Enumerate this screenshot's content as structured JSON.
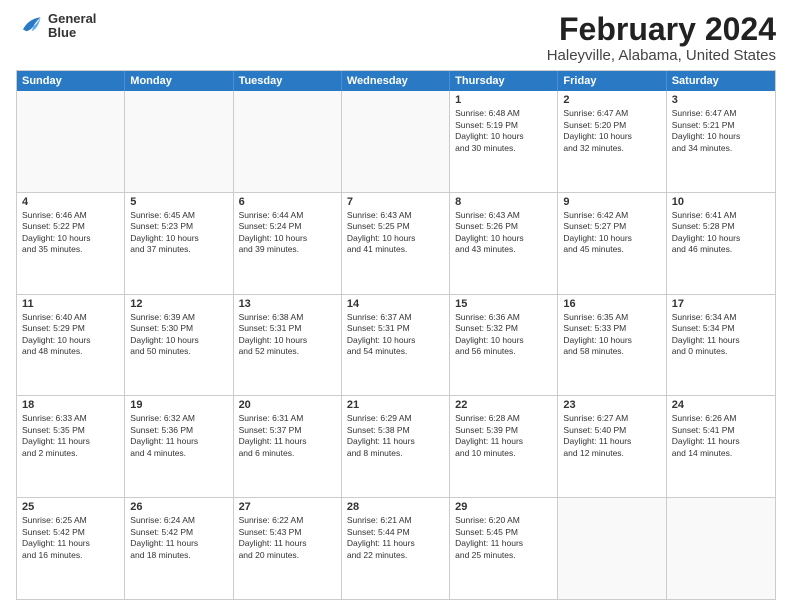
{
  "header": {
    "logo_line1": "General",
    "logo_line2": "Blue",
    "main_title": "February 2024",
    "sub_title": "Haleyville, Alabama, United States"
  },
  "days_of_week": [
    "Sunday",
    "Monday",
    "Tuesday",
    "Wednesday",
    "Thursday",
    "Friday",
    "Saturday"
  ],
  "weeks": [
    [
      {
        "day": "",
        "info": ""
      },
      {
        "day": "",
        "info": ""
      },
      {
        "day": "",
        "info": ""
      },
      {
        "day": "",
        "info": ""
      },
      {
        "day": "1",
        "info": "Sunrise: 6:48 AM\nSunset: 5:19 PM\nDaylight: 10 hours\nand 30 minutes."
      },
      {
        "day": "2",
        "info": "Sunrise: 6:47 AM\nSunset: 5:20 PM\nDaylight: 10 hours\nand 32 minutes."
      },
      {
        "day": "3",
        "info": "Sunrise: 6:47 AM\nSunset: 5:21 PM\nDaylight: 10 hours\nand 34 minutes."
      }
    ],
    [
      {
        "day": "4",
        "info": "Sunrise: 6:46 AM\nSunset: 5:22 PM\nDaylight: 10 hours\nand 35 minutes."
      },
      {
        "day": "5",
        "info": "Sunrise: 6:45 AM\nSunset: 5:23 PM\nDaylight: 10 hours\nand 37 minutes."
      },
      {
        "day": "6",
        "info": "Sunrise: 6:44 AM\nSunset: 5:24 PM\nDaylight: 10 hours\nand 39 minutes."
      },
      {
        "day": "7",
        "info": "Sunrise: 6:43 AM\nSunset: 5:25 PM\nDaylight: 10 hours\nand 41 minutes."
      },
      {
        "day": "8",
        "info": "Sunrise: 6:43 AM\nSunset: 5:26 PM\nDaylight: 10 hours\nand 43 minutes."
      },
      {
        "day": "9",
        "info": "Sunrise: 6:42 AM\nSunset: 5:27 PM\nDaylight: 10 hours\nand 45 minutes."
      },
      {
        "day": "10",
        "info": "Sunrise: 6:41 AM\nSunset: 5:28 PM\nDaylight: 10 hours\nand 46 minutes."
      }
    ],
    [
      {
        "day": "11",
        "info": "Sunrise: 6:40 AM\nSunset: 5:29 PM\nDaylight: 10 hours\nand 48 minutes."
      },
      {
        "day": "12",
        "info": "Sunrise: 6:39 AM\nSunset: 5:30 PM\nDaylight: 10 hours\nand 50 minutes."
      },
      {
        "day": "13",
        "info": "Sunrise: 6:38 AM\nSunset: 5:31 PM\nDaylight: 10 hours\nand 52 minutes."
      },
      {
        "day": "14",
        "info": "Sunrise: 6:37 AM\nSunset: 5:31 PM\nDaylight: 10 hours\nand 54 minutes."
      },
      {
        "day": "15",
        "info": "Sunrise: 6:36 AM\nSunset: 5:32 PM\nDaylight: 10 hours\nand 56 minutes."
      },
      {
        "day": "16",
        "info": "Sunrise: 6:35 AM\nSunset: 5:33 PM\nDaylight: 10 hours\nand 58 minutes."
      },
      {
        "day": "17",
        "info": "Sunrise: 6:34 AM\nSunset: 5:34 PM\nDaylight: 11 hours\nand 0 minutes."
      }
    ],
    [
      {
        "day": "18",
        "info": "Sunrise: 6:33 AM\nSunset: 5:35 PM\nDaylight: 11 hours\nand 2 minutes."
      },
      {
        "day": "19",
        "info": "Sunrise: 6:32 AM\nSunset: 5:36 PM\nDaylight: 11 hours\nand 4 minutes."
      },
      {
        "day": "20",
        "info": "Sunrise: 6:31 AM\nSunset: 5:37 PM\nDaylight: 11 hours\nand 6 minutes."
      },
      {
        "day": "21",
        "info": "Sunrise: 6:29 AM\nSunset: 5:38 PM\nDaylight: 11 hours\nand 8 minutes."
      },
      {
        "day": "22",
        "info": "Sunrise: 6:28 AM\nSunset: 5:39 PM\nDaylight: 11 hours\nand 10 minutes."
      },
      {
        "day": "23",
        "info": "Sunrise: 6:27 AM\nSunset: 5:40 PM\nDaylight: 11 hours\nand 12 minutes."
      },
      {
        "day": "24",
        "info": "Sunrise: 6:26 AM\nSunset: 5:41 PM\nDaylight: 11 hours\nand 14 minutes."
      }
    ],
    [
      {
        "day": "25",
        "info": "Sunrise: 6:25 AM\nSunset: 5:42 PM\nDaylight: 11 hours\nand 16 minutes."
      },
      {
        "day": "26",
        "info": "Sunrise: 6:24 AM\nSunset: 5:42 PM\nDaylight: 11 hours\nand 18 minutes."
      },
      {
        "day": "27",
        "info": "Sunrise: 6:22 AM\nSunset: 5:43 PM\nDaylight: 11 hours\nand 20 minutes."
      },
      {
        "day": "28",
        "info": "Sunrise: 6:21 AM\nSunset: 5:44 PM\nDaylight: 11 hours\nand 22 minutes."
      },
      {
        "day": "29",
        "info": "Sunrise: 6:20 AM\nSunset: 5:45 PM\nDaylight: 11 hours\nand 25 minutes."
      },
      {
        "day": "",
        "info": ""
      },
      {
        "day": "",
        "info": ""
      }
    ]
  ]
}
